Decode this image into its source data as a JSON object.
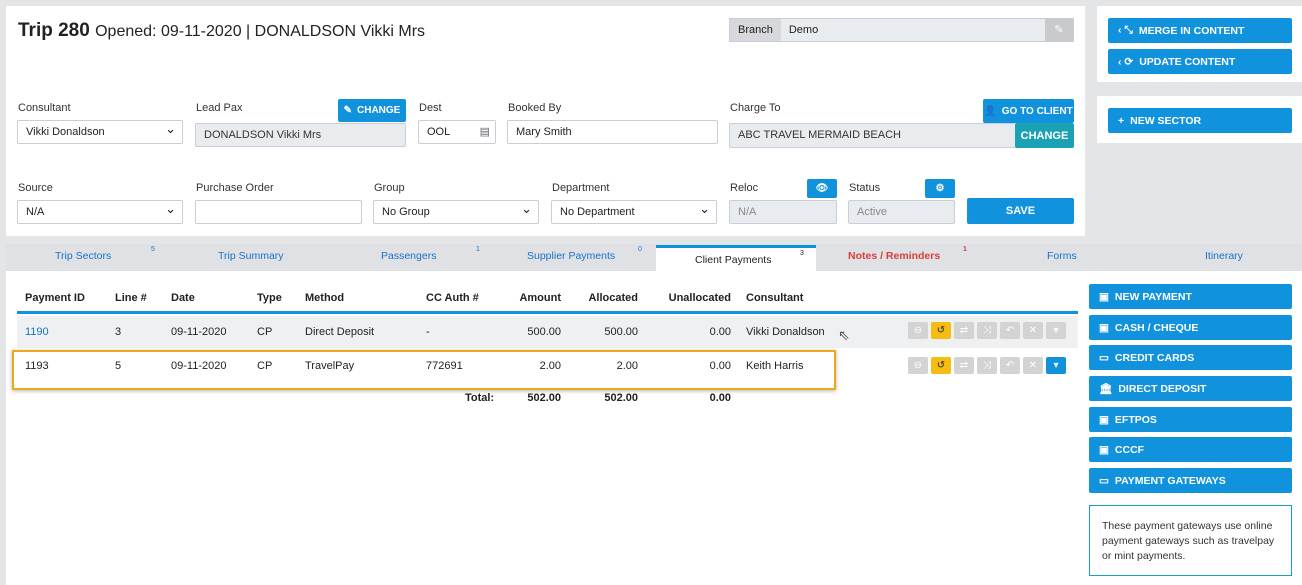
{
  "header": {
    "trip": "Trip 280",
    "opened": "Opened: 09-11-2020 | DONALDSON Vikki Mrs",
    "branch_label": "Branch",
    "branch_value": "Demo"
  },
  "fields": {
    "consultant_label": "Consultant",
    "consultant": "Vikki Donaldson",
    "lead_pax_label": "Lead Pax",
    "lead_pax": "DONALDSON Vikki Mrs",
    "change": "CHANGE",
    "dest_label": "Dest",
    "dest": "OOL",
    "booked_by_label": "Booked By",
    "booked_by": "Mary Smith",
    "charge_to_label": "Charge To",
    "charge_to": "ABC TRAVEL MERMAID BEACH",
    "go_to_client": "GO TO CLIENT",
    "charge_change": "CHANGE",
    "source_label": "Source",
    "source": "N/A",
    "po_label": "Purchase Order",
    "po": "",
    "group_label": "Group",
    "group": "No Group",
    "department_label": "Department",
    "department": "No Department",
    "reloc_label": "Reloc",
    "reloc": "N/A",
    "status_label": "Status",
    "status": "Active",
    "save": "SAVE"
  },
  "side_top": {
    "merge": "MERGE IN CONTENT",
    "update": "UPDATE CONTENT",
    "new_sector": "NEW SECTOR"
  },
  "tabs": [
    {
      "label": "Trip Sectors",
      "count": "5"
    },
    {
      "label": "Trip Summary",
      "count": ""
    },
    {
      "label": "Passengers",
      "count": "1"
    },
    {
      "label": "Supplier Payments",
      "count": "0"
    },
    {
      "label": "Client Payments",
      "count": "3"
    },
    {
      "label": "Notes / Reminders",
      "count": "1"
    },
    {
      "label": "Forms",
      "count": ""
    },
    {
      "label": "Itinerary",
      "count": ""
    }
  ],
  "table": {
    "headers": [
      "Payment ID",
      "Line #",
      "Date",
      "Type",
      "Method",
      "CC Auth #",
      "Amount",
      "Allocated",
      "Unallocated",
      "Consultant"
    ],
    "rows": [
      [
        "1190",
        "3",
        "09-11-2020",
        "CP",
        "Direct Deposit",
        "-",
        "500.00",
        "500.00",
        "0.00",
        "Vikki Donaldson"
      ],
      [
        "1193",
        "5",
        "09-11-2020",
        "CP",
        "TravelPay",
        "772691",
        "2.00",
        "2.00",
        "0.00",
        "Keith Harris"
      ]
    ],
    "total_label": "Total:",
    "total_amount": "502.00",
    "total_allocated": "502.00",
    "total_unallocated": "0.00"
  },
  "payments": {
    "new_payment": "NEW PAYMENT",
    "cash": "CASH / CHEQUE",
    "credit": "CREDIT CARDS",
    "direct": "DIRECT DEPOSIT",
    "eftpos": "EFTPOS",
    "cccf": "CCCF",
    "gateways": "PAYMENT GATEWAYS",
    "note": "These payment gateways use online payment gateways such as travelpay or mint payments."
  }
}
